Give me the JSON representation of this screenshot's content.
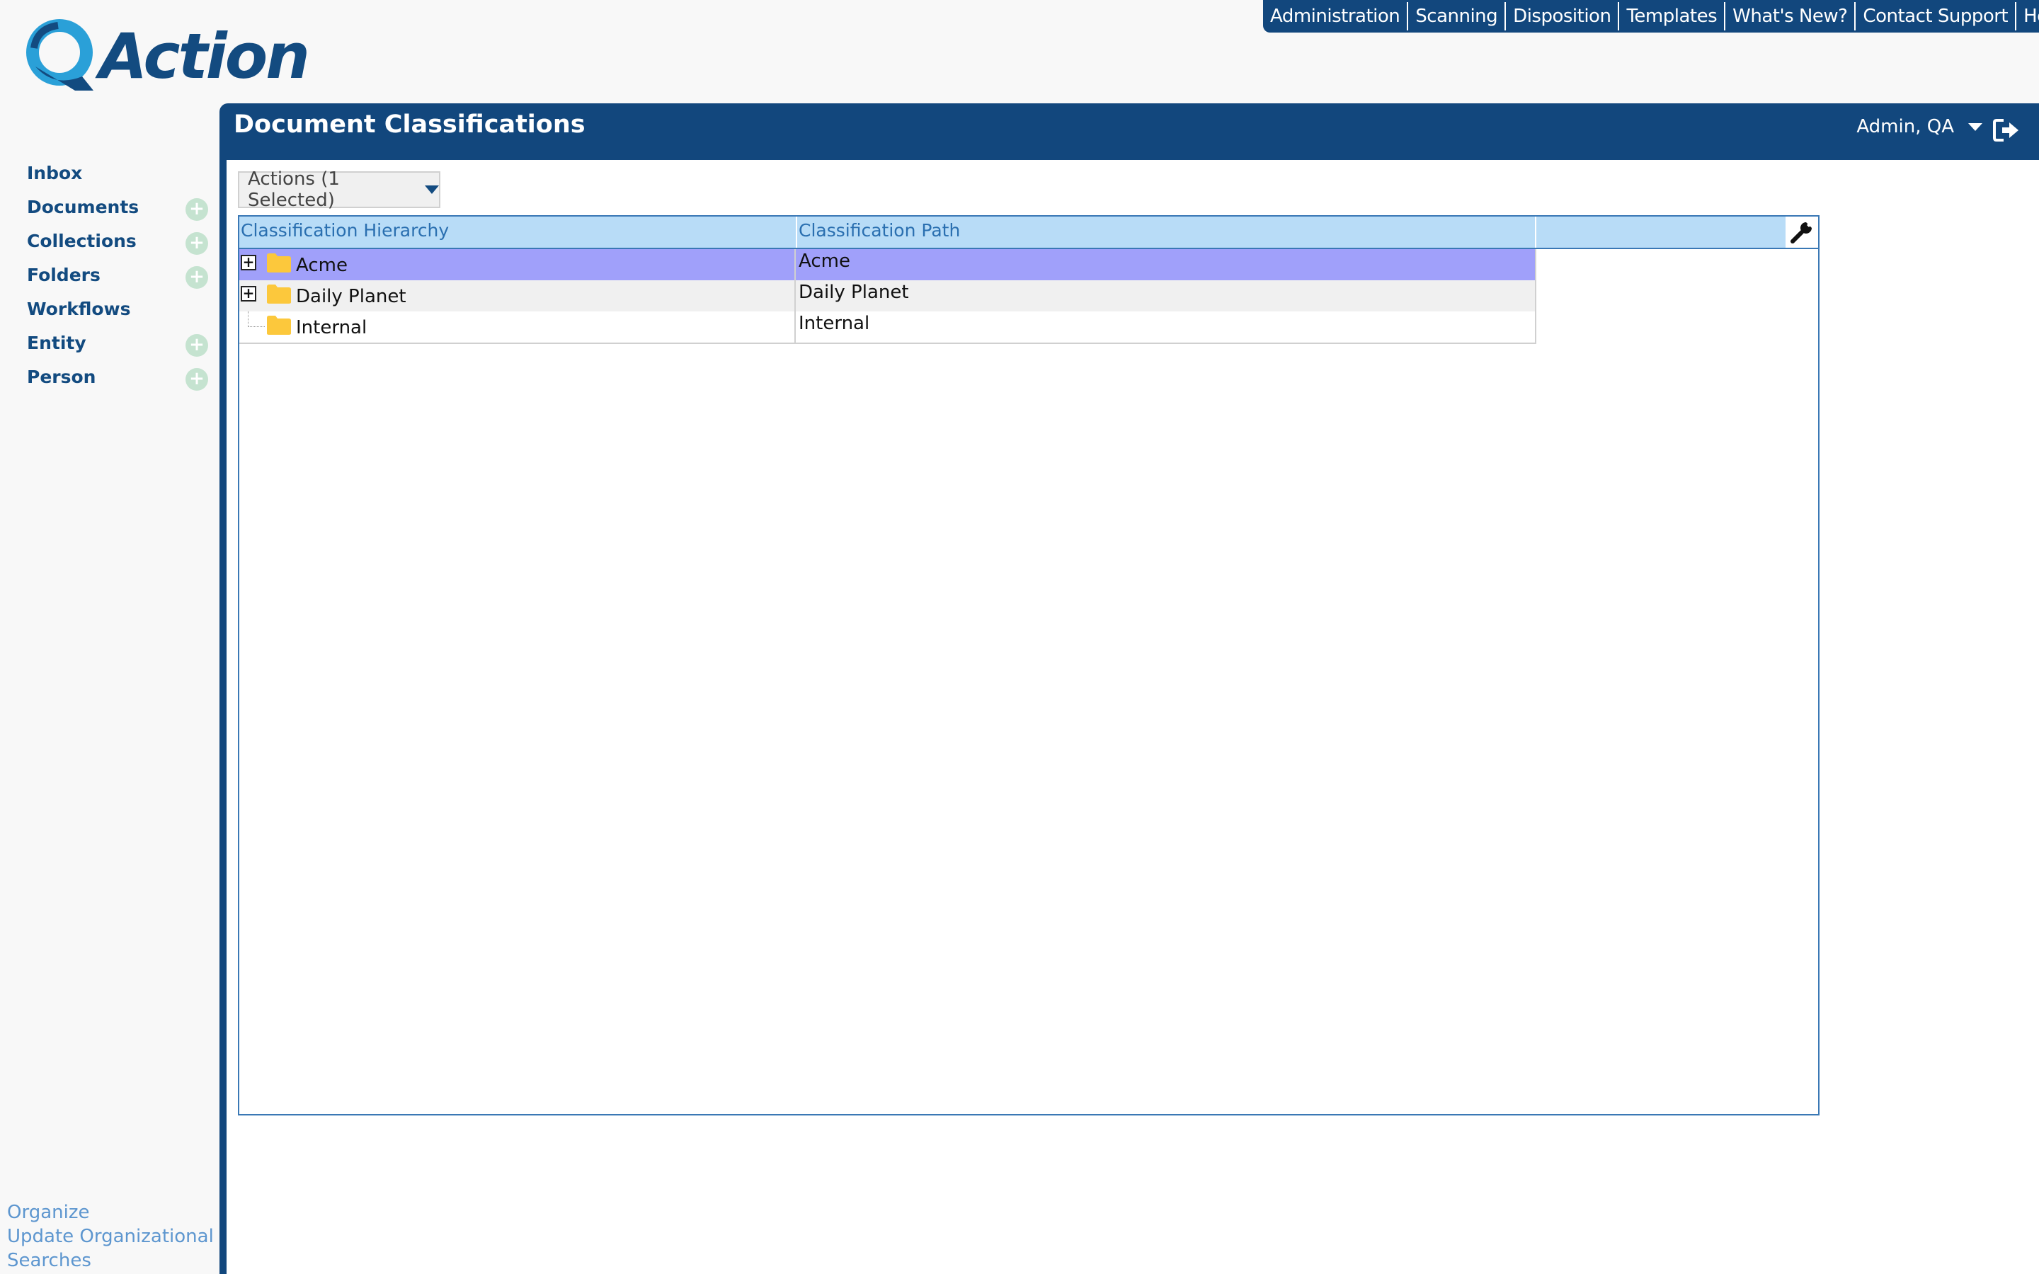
{
  "app": {
    "logo_text": "Action",
    "brand_color": "#134b80",
    "accent_color": "#2aa0d8"
  },
  "topnav": {
    "items": [
      "Administration",
      "Scanning",
      "Disposition",
      "Templates",
      "What's New?",
      "Contact Support",
      "Help"
    ]
  },
  "sidebar": {
    "items": [
      {
        "label": "Inbox",
        "has_add": false
      },
      {
        "label": "Documents",
        "has_add": true
      },
      {
        "label": "Collections",
        "has_add": true
      },
      {
        "label": "Folders",
        "has_add": true
      },
      {
        "label": "Workflows",
        "has_add": false
      },
      {
        "label": "Entity",
        "has_add": true
      },
      {
        "label": "Person",
        "has_add": true
      }
    ],
    "bottom_links": [
      "Organize",
      "Update Organizational",
      "Searches"
    ]
  },
  "main": {
    "title": "Document Classifications",
    "user_label": "Admin, QA",
    "actions_label": "Actions (1 Selected)"
  },
  "grid": {
    "columns": [
      "Classification Hierarchy",
      "Classification Path"
    ],
    "rows": [
      {
        "name": "Acme",
        "path": "Acme",
        "expandable": true,
        "selected": true
      },
      {
        "name": "Daily Planet",
        "path": "Daily Planet",
        "expandable": true,
        "selected": false
      },
      {
        "name": "Internal",
        "path": "Internal",
        "expandable": false,
        "selected": false
      }
    ]
  }
}
